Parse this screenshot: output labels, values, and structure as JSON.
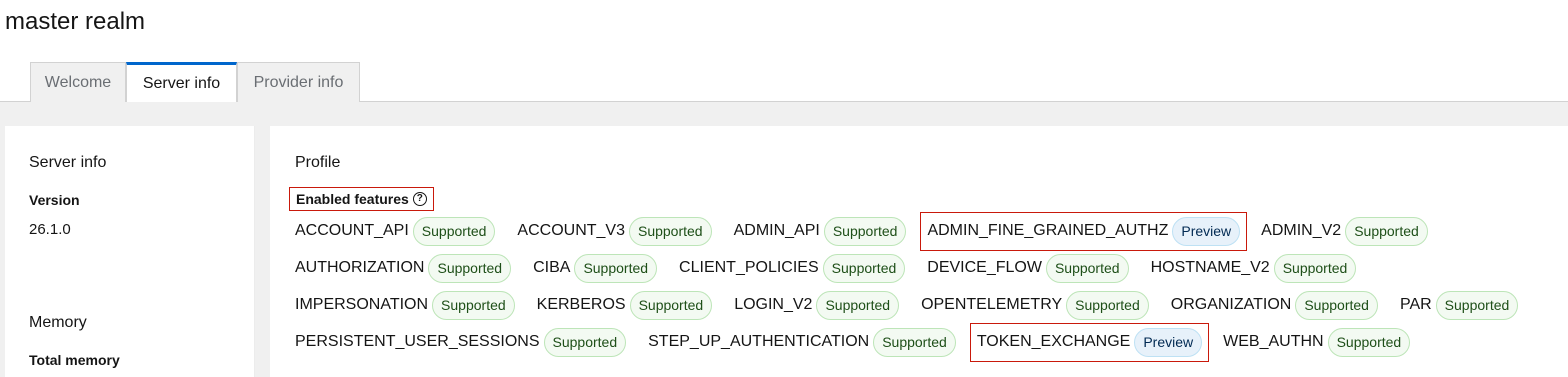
{
  "title": "master realm",
  "tabs": [
    {
      "label": "Welcome"
    },
    {
      "label": "Server info"
    },
    {
      "label": "Provider info"
    }
  ],
  "server_info": {
    "heading": "Server info",
    "version_label": "Version",
    "version_value": "26.1.0",
    "memory_heading": "Memory",
    "total_memory_label": "Total memory"
  },
  "profile": {
    "heading": "Profile",
    "enabled_features_label": "Enabled features",
    "rows": [
      [
        {
          "name": "ACCOUNT_API",
          "status": "Supported"
        },
        {
          "name": "ACCOUNT_V3",
          "status": "Supported"
        },
        {
          "name": "ADMIN_API",
          "status": "Supported"
        },
        {
          "name": "ADMIN_FINE_GRAINED_AUTHZ",
          "status": "Preview"
        },
        {
          "name": "ADMIN_V2",
          "status": "Supported"
        }
      ],
      [
        {
          "name": "AUTHORIZATION",
          "status": "Supported"
        },
        {
          "name": "CIBA",
          "status": "Supported"
        },
        {
          "name": "CLIENT_POLICIES",
          "status": "Supported"
        },
        {
          "name": "DEVICE_FLOW",
          "status": "Supported"
        },
        {
          "name": "HOSTNAME_V2",
          "status": "Supported"
        }
      ],
      [
        {
          "name": "IMPERSONATION",
          "status": "Supported"
        },
        {
          "name": "KERBEROS",
          "status": "Supported"
        },
        {
          "name": "LOGIN_V2",
          "status": "Supported"
        },
        {
          "name": "OPENTELEMETRY",
          "status": "Supported"
        },
        {
          "name": "ORGANIZATION",
          "status": "Supported"
        },
        {
          "name": "PAR",
          "status": "Supported"
        }
      ],
      [
        {
          "name": "PERSISTENT_USER_SESSIONS",
          "status": "Supported"
        },
        {
          "name": "STEP_UP_AUTHENTICATION",
          "status": "Supported"
        },
        {
          "name": "TOKEN_EXCHANGE",
          "status": "Preview"
        },
        {
          "name": "WEB_AUTHN",
          "status": "Supported"
        }
      ]
    ]
  },
  "colors": {
    "accent": "#0066cc",
    "supported_bg": "#f3faf2",
    "preview_bg": "#e7f1fa",
    "highlight_border": "#c9190b"
  }
}
